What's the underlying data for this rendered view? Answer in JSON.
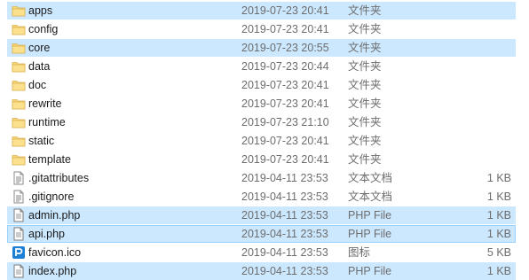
{
  "colors": {
    "selected_bg": "#cce8ff",
    "focus_border": "#99d1ff",
    "folder": "#f8d775",
    "meta_text": "#6d6d6d",
    "php_icon": "#2a6ac8",
    "ico_icon": "#1d7fd6"
  },
  "files": [
    {
      "name": "apps",
      "date": "2019-07-23 20:41",
      "type": "文件夹",
      "size": "",
      "icon": "folder-icon",
      "state": "selected"
    },
    {
      "name": "config",
      "date": "2019-07-23 20:41",
      "type": "文件夹",
      "size": "",
      "icon": "folder-icon",
      "state": ""
    },
    {
      "name": "core",
      "date": "2019-07-23 20:55",
      "type": "文件夹",
      "size": "",
      "icon": "folder-icon",
      "state": "selected"
    },
    {
      "name": "data",
      "date": "2019-07-23 20:44",
      "type": "文件夹",
      "size": "",
      "icon": "folder-icon",
      "state": ""
    },
    {
      "name": "doc",
      "date": "2019-07-23 20:41",
      "type": "文件夹",
      "size": "",
      "icon": "folder-icon",
      "state": ""
    },
    {
      "name": "rewrite",
      "date": "2019-07-23 20:41",
      "type": "文件夹",
      "size": "",
      "icon": "folder-icon",
      "state": ""
    },
    {
      "name": "runtime",
      "date": "2019-07-23 21:10",
      "type": "文件夹",
      "size": "",
      "icon": "folder-icon",
      "state": ""
    },
    {
      "name": "static",
      "date": "2019-07-23 20:41",
      "type": "文件夹",
      "size": "",
      "icon": "folder-icon",
      "state": ""
    },
    {
      "name": "template",
      "date": "2019-07-23 20:41",
      "type": "文件夹",
      "size": "",
      "icon": "folder-icon",
      "state": ""
    },
    {
      "name": ".gitattributes",
      "date": "2019-04-11 23:53",
      "type": "文本文档",
      "size": "1 KB",
      "icon": "text-document-icon",
      "state": ""
    },
    {
      "name": ".gitignore",
      "date": "2019-04-11 23:53",
      "type": "文本文档",
      "size": "1 KB",
      "icon": "text-document-icon",
      "state": ""
    },
    {
      "name": "admin.php",
      "date": "2019-04-11 23:53",
      "type": "PHP File",
      "size": "1 KB",
      "icon": "php-file-icon",
      "state": "selected"
    },
    {
      "name": "api.php",
      "date": "2019-04-11 23:53",
      "type": "PHP File",
      "size": "1 KB",
      "icon": "php-file-icon",
      "state": "focused"
    },
    {
      "name": "favicon.ico",
      "date": "2019-04-11 23:53",
      "type": "图标",
      "size": "5 KB",
      "icon": "ico-file-icon",
      "state": ""
    },
    {
      "name": "index.php",
      "date": "2019-04-11 23:53",
      "type": "PHP File",
      "size": "1 KB",
      "icon": "php-file-icon",
      "state": "selected"
    }
  ]
}
